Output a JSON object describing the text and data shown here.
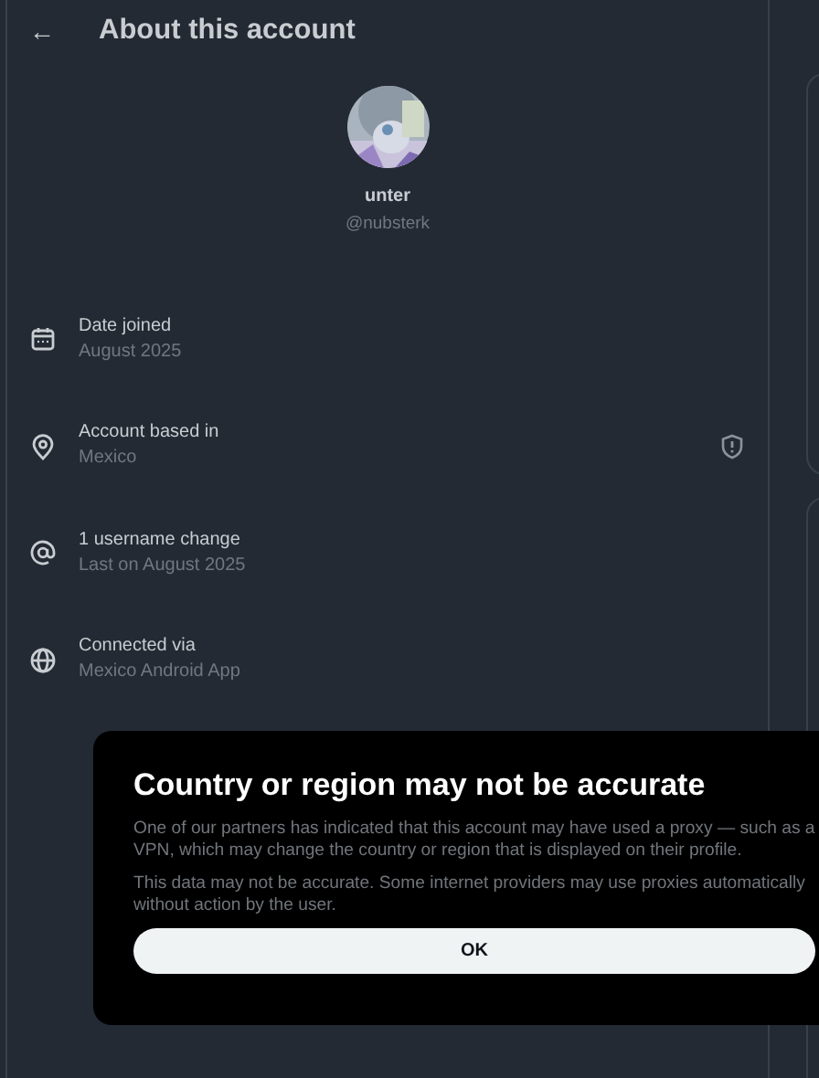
{
  "header": {
    "back": "←",
    "title": "About this account"
  },
  "profile": {
    "name": "unter",
    "handle": "@nubsterk"
  },
  "rows": [
    {
      "label": "Date joined",
      "value": "August 2025",
      "warning": false
    },
    {
      "label": "Account based in",
      "value": "Mexico",
      "warning": true
    },
    {
      "label": "1 username change",
      "value": "Last on August 2025",
      "warning": false
    },
    {
      "label": "Connected via",
      "value": "Mexico Android App",
      "warning": false
    }
  ],
  "dialog": {
    "title": "Country or region may not be accurate",
    "paragraphs": [
      "One of our partners has indicated that this account may have used a proxy — such as a VPN, which may change the country or region that is displayed on their profile.",
      "This data may not be accurate. Some internet providers may use proxies automatically without action by the user."
    ],
    "button": "OK"
  }
}
